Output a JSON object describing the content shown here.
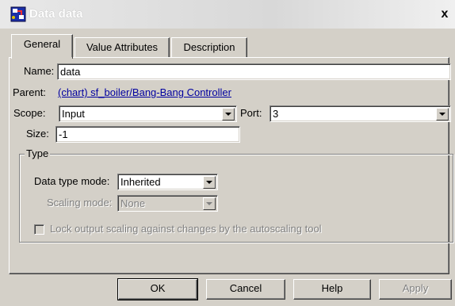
{
  "window": {
    "title": "Data data",
    "close_glyph": "x"
  },
  "tabs": [
    {
      "label": "General",
      "active": true
    },
    {
      "label": "Value Attributes",
      "active": false
    },
    {
      "label": "Description",
      "active": false
    }
  ],
  "general": {
    "name_label": "Name:",
    "name_value": "data",
    "parent_label": "Parent:",
    "parent_link": "(chart) sf_boiler/Bang-Bang Controller",
    "scope_label": "Scope:",
    "scope_value": "Input",
    "port_label": "Port:",
    "port_value": "3",
    "size_label": "Size:",
    "size_value": "-1"
  },
  "type_group": {
    "title": "Type",
    "data_type_mode_label": "Data type mode:",
    "data_type_mode_value": "Inherited",
    "scaling_mode_label": "Scaling mode:",
    "scaling_mode_value": "None",
    "scaling_mode_enabled": false,
    "lock_label": "Lock output scaling against changes by the autoscaling tool",
    "lock_checked": false,
    "lock_enabled": false
  },
  "buttons": {
    "ok": "OK",
    "cancel": "Cancel",
    "help": "Help",
    "apply": "Apply"
  },
  "icons": {
    "window_icon": "stateflow-chart-icon"
  },
  "colors": {
    "link": "#0000a0",
    "face": "#d4d0c8",
    "disabled_text": "#808080"
  }
}
